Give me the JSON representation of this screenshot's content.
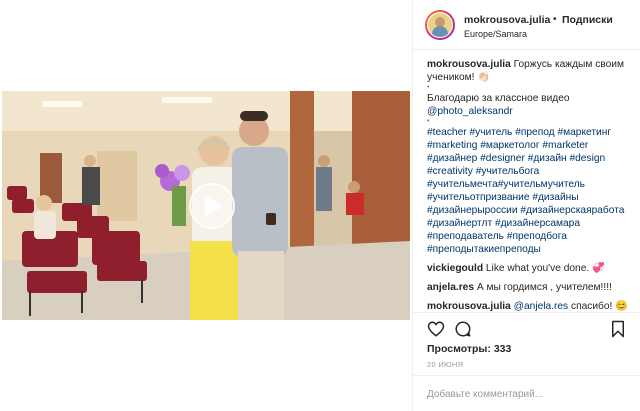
{
  "post": {
    "username": "mokrousova.julia",
    "separator": "•",
    "follow_label": "Подписки",
    "location": "Europe/Samara"
  },
  "caption": {
    "author": "mokrousova.julia",
    "lines": [
      "Горжусь каждым своим",
      "учеником! 👏🏻"
    ],
    "thanks": "Благодарю за классное видео",
    "mention": "@photo_aleksandr",
    "hashtags": [
      "#teacher #учитель #препод #маркетинг",
      "#marketing #маркетолог #marketer",
      "#дизайнер #designer #дизайн #design",
      "#creativity #учительбога",
      "#учительмечта#учительмучитель",
      "#учительотпризвание #дизайны",
      "#дизайнерыроссии #дизайнерскаяработа",
      "#дизайнертлт #дизайнерсамара",
      "#преподаватель #преподбога",
      "#преподытакиепреподы"
    ]
  },
  "comments": [
    {
      "user": "vickiegould",
      "text": "Like what you've done. 💞"
    },
    {
      "user": "anjela.res",
      "text": "А мы гордимся , учителем!!!!"
    },
    {
      "user": "mokrousova.julia",
      "mention": "@anjela.res",
      "text": "спасибо! 😊"
    }
  ],
  "stats": {
    "views_label": "Просмотры:",
    "views_count": "333",
    "date": "20 ИЮНЯ"
  },
  "add_comment": {
    "placeholder": "Добавьте комментарий..."
  },
  "icons": {
    "like": "heart-icon",
    "comment": "comment-icon",
    "save": "bookmark-icon",
    "play": "play-icon"
  }
}
